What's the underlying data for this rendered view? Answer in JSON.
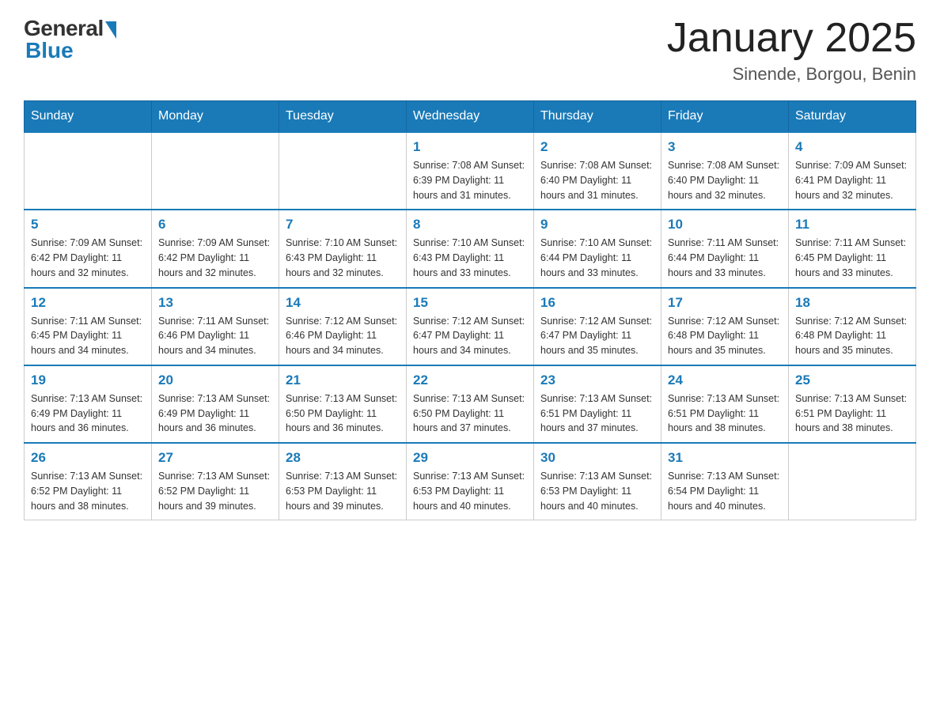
{
  "header": {
    "logo_general": "General",
    "logo_blue": "Blue",
    "month_title": "January 2025",
    "location": "Sinende, Borgou, Benin"
  },
  "days_of_week": [
    "Sunday",
    "Monday",
    "Tuesday",
    "Wednesday",
    "Thursday",
    "Friday",
    "Saturday"
  ],
  "weeks": [
    [
      {
        "day": "",
        "info": ""
      },
      {
        "day": "",
        "info": ""
      },
      {
        "day": "",
        "info": ""
      },
      {
        "day": "1",
        "info": "Sunrise: 7:08 AM\nSunset: 6:39 PM\nDaylight: 11 hours and 31 minutes."
      },
      {
        "day": "2",
        "info": "Sunrise: 7:08 AM\nSunset: 6:40 PM\nDaylight: 11 hours and 31 minutes."
      },
      {
        "day": "3",
        "info": "Sunrise: 7:08 AM\nSunset: 6:40 PM\nDaylight: 11 hours and 32 minutes."
      },
      {
        "day": "4",
        "info": "Sunrise: 7:09 AM\nSunset: 6:41 PM\nDaylight: 11 hours and 32 minutes."
      }
    ],
    [
      {
        "day": "5",
        "info": "Sunrise: 7:09 AM\nSunset: 6:42 PM\nDaylight: 11 hours and 32 minutes."
      },
      {
        "day": "6",
        "info": "Sunrise: 7:09 AM\nSunset: 6:42 PM\nDaylight: 11 hours and 32 minutes."
      },
      {
        "day": "7",
        "info": "Sunrise: 7:10 AM\nSunset: 6:43 PM\nDaylight: 11 hours and 32 minutes."
      },
      {
        "day": "8",
        "info": "Sunrise: 7:10 AM\nSunset: 6:43 PM\nDaylight: 11 hours and 33 minutes."
      },
      {
        "day": "9",
        "info": "Sunrise: 7:10 AM\nSunset: 6:44 PM\nDaylight: 11 hours and 33 minutes."
      },
      {
        "day": "10",
        "info": "Sunrise: 7:11 AM\nSunset: 6:44 PM\nDaylight: 11 hours and 33 minutes."
      },
      {
        "day": "11",
        "info": "Sunrise: 7:11 AM\nSunset: 6:45 PM\nDaylight: 11 hours and 33 minutes."
      }
    ],
    [
      {
        "day": "12",
        "info": "Sunrise: 7:11 AM\nSunset: 6:45 PM\nDaylight: 11 hours and 34 minutes."
      },
      {
        "day": "13",
        "info": "Sunrise: 7:11 AM\nSunset: 6:46 PM\nDaylight: 11 hours and 34 minutes."
      },
      {
        "day": "14",
        "info": "Sunrise: 7:12 AM\nSunset: 6:46 PM\nDaylight: 11 hours and 34 minutes."
      },
      {
        "day": "15",
        "info": "Sunrise: 7:12 AM\nSunset: 6:47 PM\nDaylight: 11 hours and 34 minutes."
      },
      {
        "day": "16",
        "info": "Sunrise: 7:12 AM\nSunset: 6:47 PM\nDaylight: 11 hours and 35 minutes."
      },
      {
        "day": "17",
        "info": "Sunrise: 7:12 AM\nSunset: 6:48 PM\nDaylight: 11 hours and 35 minutes."
      },
      {
        "day": "18",
        "info": "Sunrise: 7:12 AM\nSunset: 6:48 PM\nDaylight: 11 hours and 35 minutes."
      }
    ],
    [
      {
        "day": "19",
        "info": "Sunrise: 7:13 AM\nSunset: 6:49 PM\nDaylight: 11 hours and 36 minutes."
      },
      {
        "day": "20",
        "info": "Sunrise: 7:13 AM\nSunset: 6:49 PM\nDaylight: 11 hours and 36 minutes."
      },
      {
        "day": "21",
        "info": "Sunrise: 7:13 AM\nSunset: 6:50 PM\nDaylight: 11 hours and 36 minutes."
      },
      {
        "day": "22",
        "info": "Sunrise: 7:13 AM\nSunset: 6:50 PM\nDaylight: 11 hours and 37 minutes."
      },
      {
        "day": "23",
        "info": "Sunrise: 7:13 AM\nSunset: 6:51 PM\nDaylight: 11 hours and 37 minutes."
      },
      {
        "day": "24",
        "info": "Sunrise: 7:13 AM\nSunset: 6:51 PM\nDaylight: 11 hours and 38 minutes."
      },
      {
        "day": "25",
        "info": "Sunrise: 7:13 AM\nSunset: 6:51 PM\nDaylight: 11 hours and 38 minutes."
      }
    ],
    [
      {
        "day": "26",
        "info": "Sunrise: 7:13 AM\nSunset: 6:52 PM\nDaylight: 11 hours and 38 minutes."
      },
      {
        "day": "27",
        "info": "Sunrise: 7:13 AM\nSunset: 6:52 PM\nDaylight: 11 hours and 39 minutes."
      },
      {
        "day": "28",
        "info": "Sunrise: 7:13 AM\nSunset: 6:53 PM\nDaylight: 11 hours and 39 minutes."
      },
      {
        "day": "29",
        "info": "Sunrise: 7:13 AM\nSunset: 6:53 PM\nDaylight: 11 hours and 40 minutes."
      },
      {
        "day": "30",
        "info": "Sunrise: 7:13 AM\nSunset: 6:53 PM\nDaylight: 11 hours and 40 minutes."
      },
      {
        "day": "31",
        "info": "Sunrise: 7:13 AM\nSunset: 6:54 PM\nDaylight: 11 hours and 40 minutes."
      },
      {
        "day": "",
        "info": ""
      }
    ]
  ]
}
